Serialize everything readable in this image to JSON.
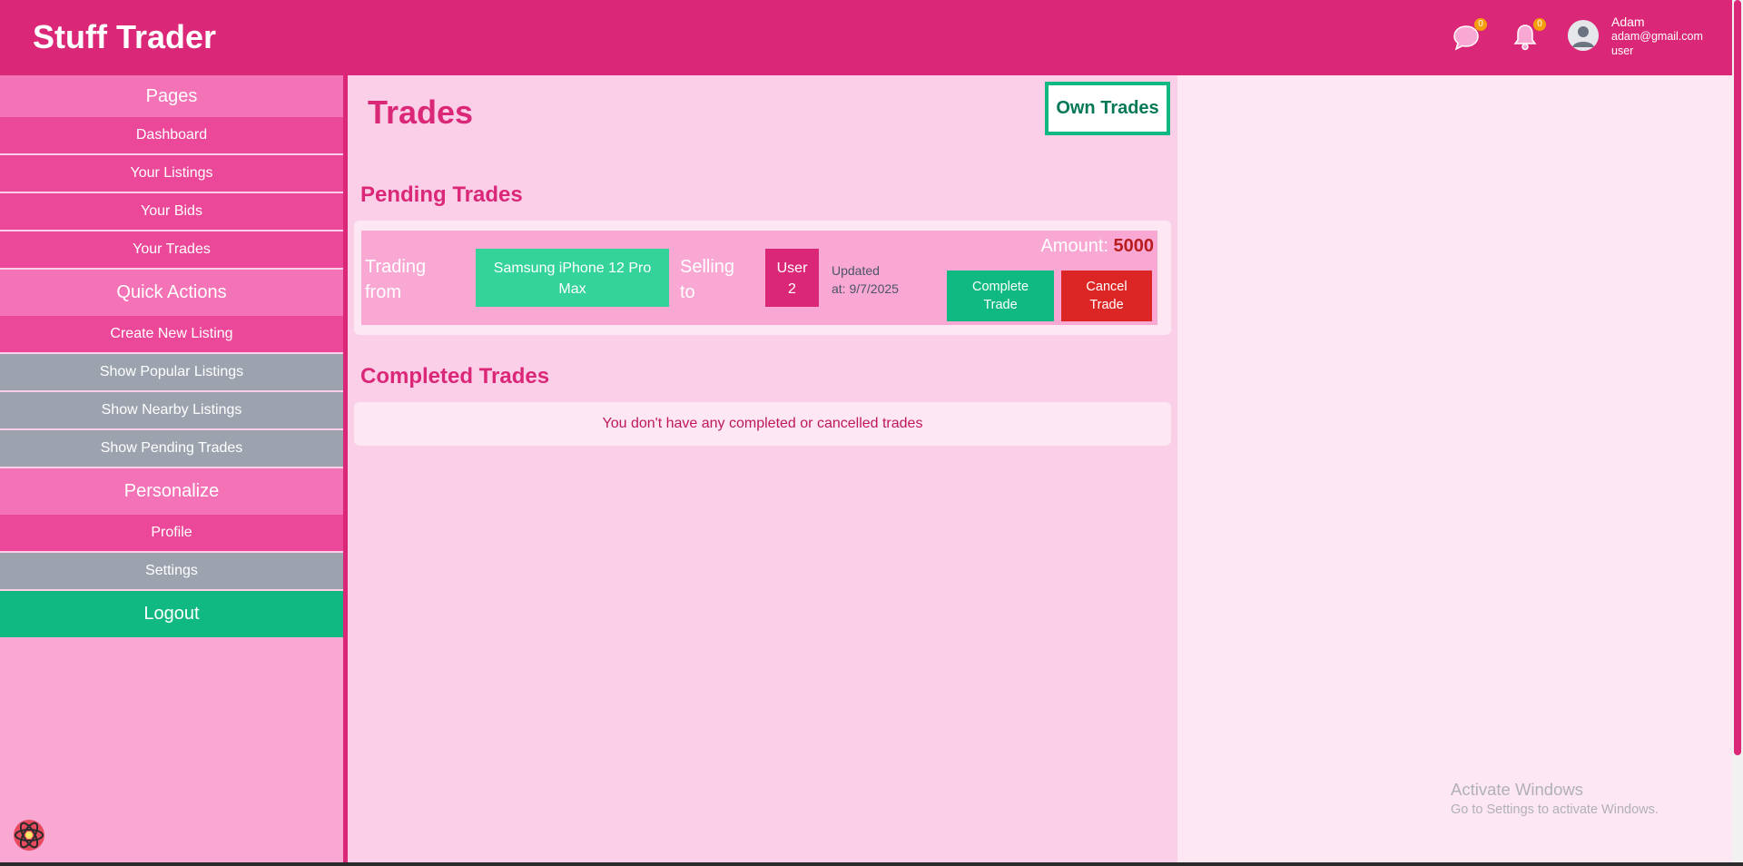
{
  "header": {
    "brand": "Stuff Trader",
    "messages_count": "0",
    "notifications_count": "0",
    "user": {
      "name": "Adam",
      "email": "adam@gmail.com",
      "role": "user"
    }
  },
  "sidebar": {
    "pages_heading": "Pages",
    "pages": [
      {
        "label": "Dashboard"
      },
      {
        "label": "Your Listings"
      },
      {
        "label": "Your Bids"
      },
      {
        "label": "Your Trades"
      }
    ],
    "quick_heading": "Quick Actions",
    "quick": [
      {
        "label": "Create New Listing"
      },
      {
        "label": "Show Popular Listings"
      },
      {
        "label": "Show Nearby Listings"
      },
      {
        "label": "Show Pending Trades"
      }
    ],
    "personalize_heading": "Personalize",
    "personalize": [
      {
        "label": "Profile"
      },
      {
        "label": "Settings"
      }
    ],
    "logout": "Logout"
  },
  "main": {
    "title": "Trades",
    "own_trades_button": "Own Trades",
    "pending_title": "Pending Trades",
    "pending_trade": {
      "trading_from_label_1": "Trading",
      "trading_from_label_2": "from",
      "item_line_1": "Samsung iPhone 12 Pro",
      "item_line_2": "Max",
      "selling_to_label_1": "Selling",
      "selling_to_label_2": "to",
      "user_line_1": "User",
      "user_line_2": "2",
      "updated_line_1": "Updated",
      "updated_line_2": "at: 9/7/2025",
      "amount_label": "Amount:",
      "amount_value": "5000",
      "complete_line_1": "Complete",
      "complete_line_2": "Trade",
      "cancel_line_1": "Cancel",
      "cancel_line_2": "Trade"
    },
    "completed_title": "Completed Trades",
    "completed_empty": "You don't have any completed or cancelled trades"
  },
  "watermark": {
    "line1": "Activate Windows",
    "line2": "Go to Settings to activate Windows."
  },
  "colors": {
    "primary": "#db2777",
    "sidebar_bg": "#f9a8d4",
    "success": "#10b981",
    "danger": "#dc2626",
    "muted": "#9ca3af"
  }
}
